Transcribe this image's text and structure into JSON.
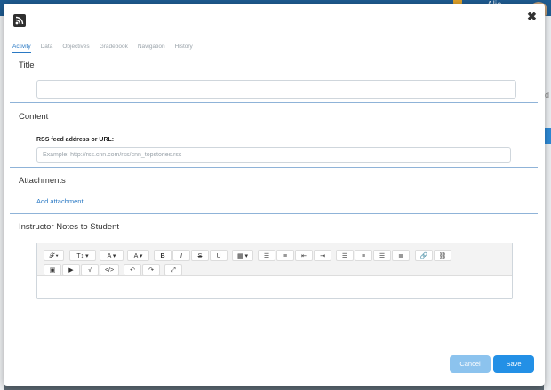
{
  "background": {
    "user_name": "Alic"
  },
  "modal": {
    "rss_icon": "rss-icon",
    "close_label": "✖",
    "tabs": [
      {
        "label": "Activity",
        "active": true
      },
      {
        "label": "Data"
      },
      {
        "label": "Objectives"
      },
      {
        "label": "Gradebook"
      },
      {
        "label": "Navigation"
      },
      {
        "label": "History"
      }
    ],
    "title_section": {
      "heading": "Title",
      "value": ""
    },
    "content_section": {
      "heading": "Content",
      "field_label": "RSS feed address or URL:",
      "placeholder": "Example: http://rss.cnn.com/rss/cnn_topstories.rss"
    },
    "attachments_section": {
      "heading": "Attachments",
      "link": "Add attachment"
    },
    "notes_section": {
      "heading": "Instructor Notes to Student"
    },
    "toolbar": {
      "font": "𝓕 ▾",
      "size": "T↕ ▾",
      "text_color": "A ▾",
      "bg_color": "A ▾",
      "bold": "B",
      "italic": "I",
      "strike": "S",
      "underline": "U",
      "table": "▦ ▾",
      "ul": "☰",
      "ol": "≡",
      "outdent": "⇤",
      "indent": "⇥",
      "left": "☰",
      "center": "≡",
      "right": "☰",
      "justify": "≣",
      "link": "🔗",
      "unlink": "⛓",
      "image": "▣",
      "video": "▶",
      "formula": "√",
      "code": "</>",
      "undo": "↶",
      "redo": "↷",
      "fullscreen": "⤢"
    },
    "buttons": {
      "cancel": "Cancel",
      "save": "Save"
    }
  },
  "colors": {
    "accent": "#2390e6",
    "cancel": "#8cc3ee",
    "link": "#2a79c4"
  }
}
